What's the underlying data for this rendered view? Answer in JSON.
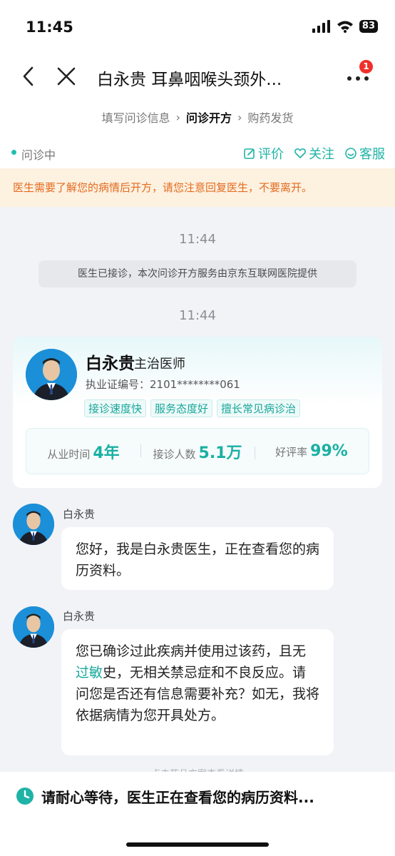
{
  "status_bar": {
    "time": "11:45",
    "battery": "83"
  },
  "nav": {
    "title": "白永贵 耳鼻咽喉头颈外...",
    "badge": "1"
  },
  "steps": {
    "step1": "填写问诊信息",
    "step2": "问诊开方",
    "step3": "购药发货",
    "separator": "›"
  },
  "consult": {
    "status": "问诊中",
    "actions": {
      "rate": "评价",
      "follow": "关注",
      "service": "客服"
    }
  },
  "warning": "医生需要了解您的病情后开方，请您注意回复医生，不要离开。",
  "chat": {
    "time1": "11:44",
    "system_notice": "医生已接诊，本次问诊开方服务由京东互联网医院提供",
    "time2": "11:44",
    "messages": [
      {
        "sender": "白永贵",
        "text": "您好，我是白永贵医生，正在查看您的病历资料。"
      },
      {
        "sender": "白永贵",
        "text_before": "您已确诊过此疾病并使用过该药，且无",
        "text_highlight": "过敏",
        "text_after": "史，无相关禁忌症和不良反应。请问您是否还有信息需要补充？如无，我将依据病情为您开具处方。"
      }
    ],
    "faded_text": "点击药品方案查看详情"
  },
  "doctor_card": {
    "name": "白永贵",
    "title": "主治医师",
    "license_label": "执业证编号：",
    "license_number": "2101********061",
    "tags": [
      "接诊速度快",
      "服务态度好",
      "擅长常见病诊治"
    ],
    "stats": [
      {
        "label": "从业时间",
        "value": "4年"
      },
      {
        "label": "接诊人数",
        "value": "5.1万"
      },
      {
        "label": "好评率",
        "value": "99%"
      }
    ]
  },
  "bottom": {
    "text": "请耐心等待，医生正在查看您的病历资料..."
  },
  "colors": {
    "accent": "#20b3a6",
    "warning_bg": "#fdf1e0",
    "warning_text": "#e36b1f",
    "badge": "#f0302a"
  }
}
